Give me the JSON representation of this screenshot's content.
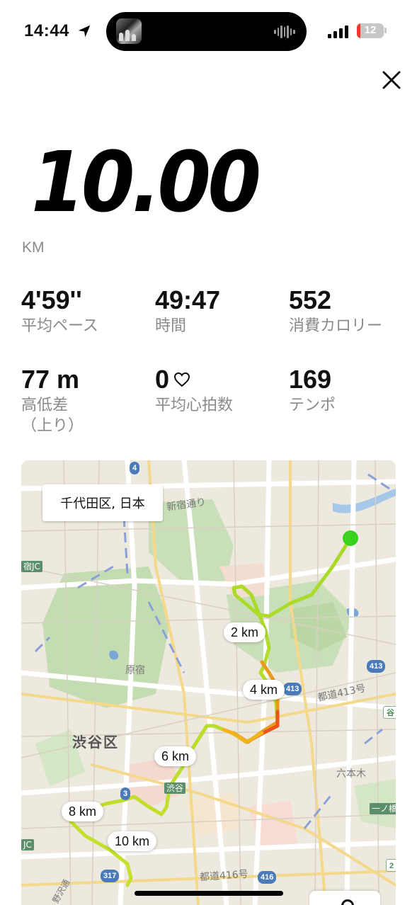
{
  "status_bar": {
    "time": "14:44",
    "battery": "12",
    "colors": {
      "battery_low": "#e93a2e"
    }
  },
  "summary": {
    "distance": "10.00",
    "unit": "KM"
  },
  "stats": [
    {
      "value": "4'59''",
      "label": "平均ペース"
    },
    {
      "value": "49:47",
      "label": "時間"
    },
    {
      "value": "552",
      "label": "消費カロリー"
    },
    {
      "value": "77 m",
      "label": "高低差\n（上り）"
    },
    {
      "value": "0",
      "label": "平均心拍数",
      "icon": "heart-outline-icon"
    },
    {
      "value": "169",
      "label": "テンポ"
    }
  ],
  "map": {
    "title": "千代田区, 日本",
    "km_markers": [
      "2 km",
      "4 km",
      "6 km",
      "8 km",
      "10 km"
    ],
    "place_labels": [
      "新宿通り",
      "原宿",
      "渋谷区",
      "都道413号",
      "六本木",
      "都道416号",
      "渋谷",
      "宿JC",
      "JC",
      "一ノ橋",
      "野沢通"
    ],
    "route_shields": [
      "4",
      "413",
      "413",
      "3",
      "317",
      "416",
      "谷",
      "2"
    ],
    "colors": {
      "route_fast": "#a6d92a",
      "route_slow": "#e8541c",
      "start": "#3bd11f"
    }
  }
}
